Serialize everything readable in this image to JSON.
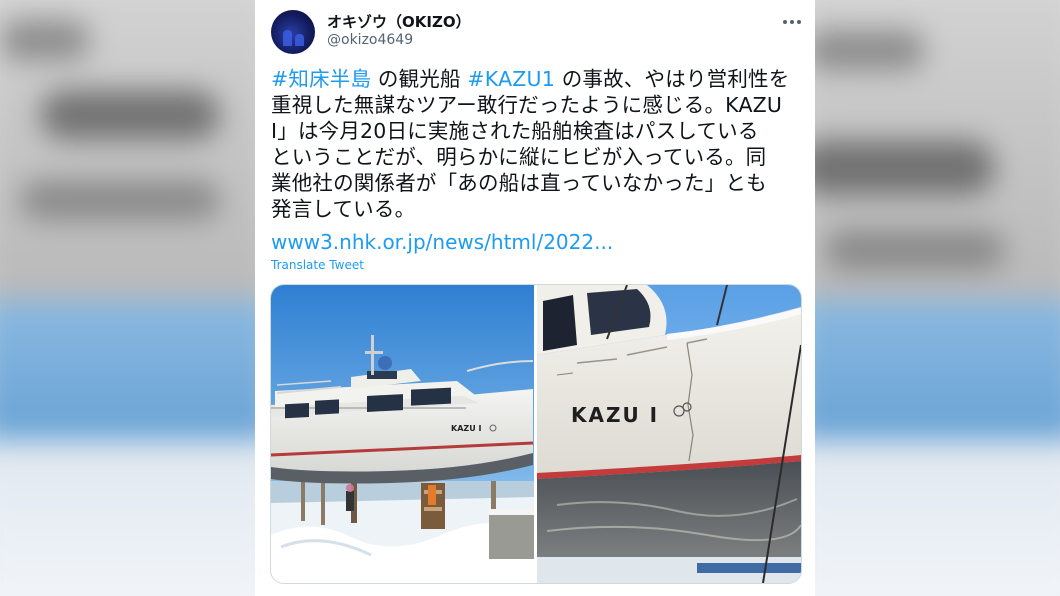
{
  "tweet": {
    "author_name": "オキゾウ（OKIZO）",
    "author_handle": "@okizo4649",
    "text_lines": [
      [
        {
          "text": "#知床半島",
          "hashtag": true
        },
        {
          "text": " の観光船 ",
          "hashtag": false
        },
        {
          "text": "#KAZU1",
          "hashtag": true
        },
        {
          "text": " の事故、やはり営利性を",
          "hashtag": false
        }
      ],
      [
        {
          "text": "重視した無謀なツアー敢行だったように感じる。KAZU",
          "hashtag": false
        }
      ],
      [
        {
          "text": "Ⅰ」は今月20日に実施された船舶検査はパスしている",
          "hashtag": false
        }
      ],
      [
        {
          "text": "ということだが、明らかに縦にヒビが入っている。同",
          "hashtag": false
        }
      ],
      [
        {
          "text": "業他社の関係者が「あの船は直っていなかった」とも",
          "hashtag": false
        }
      ],
      [
        {
          "text": "発言している。",
          "hashtag": false
        }
      ]
    ],
    "link_text": "www3.nhk.or.jp/news/html/2022...",
    "translate_label": "Translate Tweet",
    "more_icon": "more-horizontal-icon"
  },
  "photos": [
    {
      "hull_label": "KAZU Ⅰ"
    },
    {
      "hull_label": "KAZU Ⅰ"
    }
  ],
  "colors": {
    "link": "#1d9bf0",
    "text": "#0f1419",
    "secondary": "#536471"
  }
}
